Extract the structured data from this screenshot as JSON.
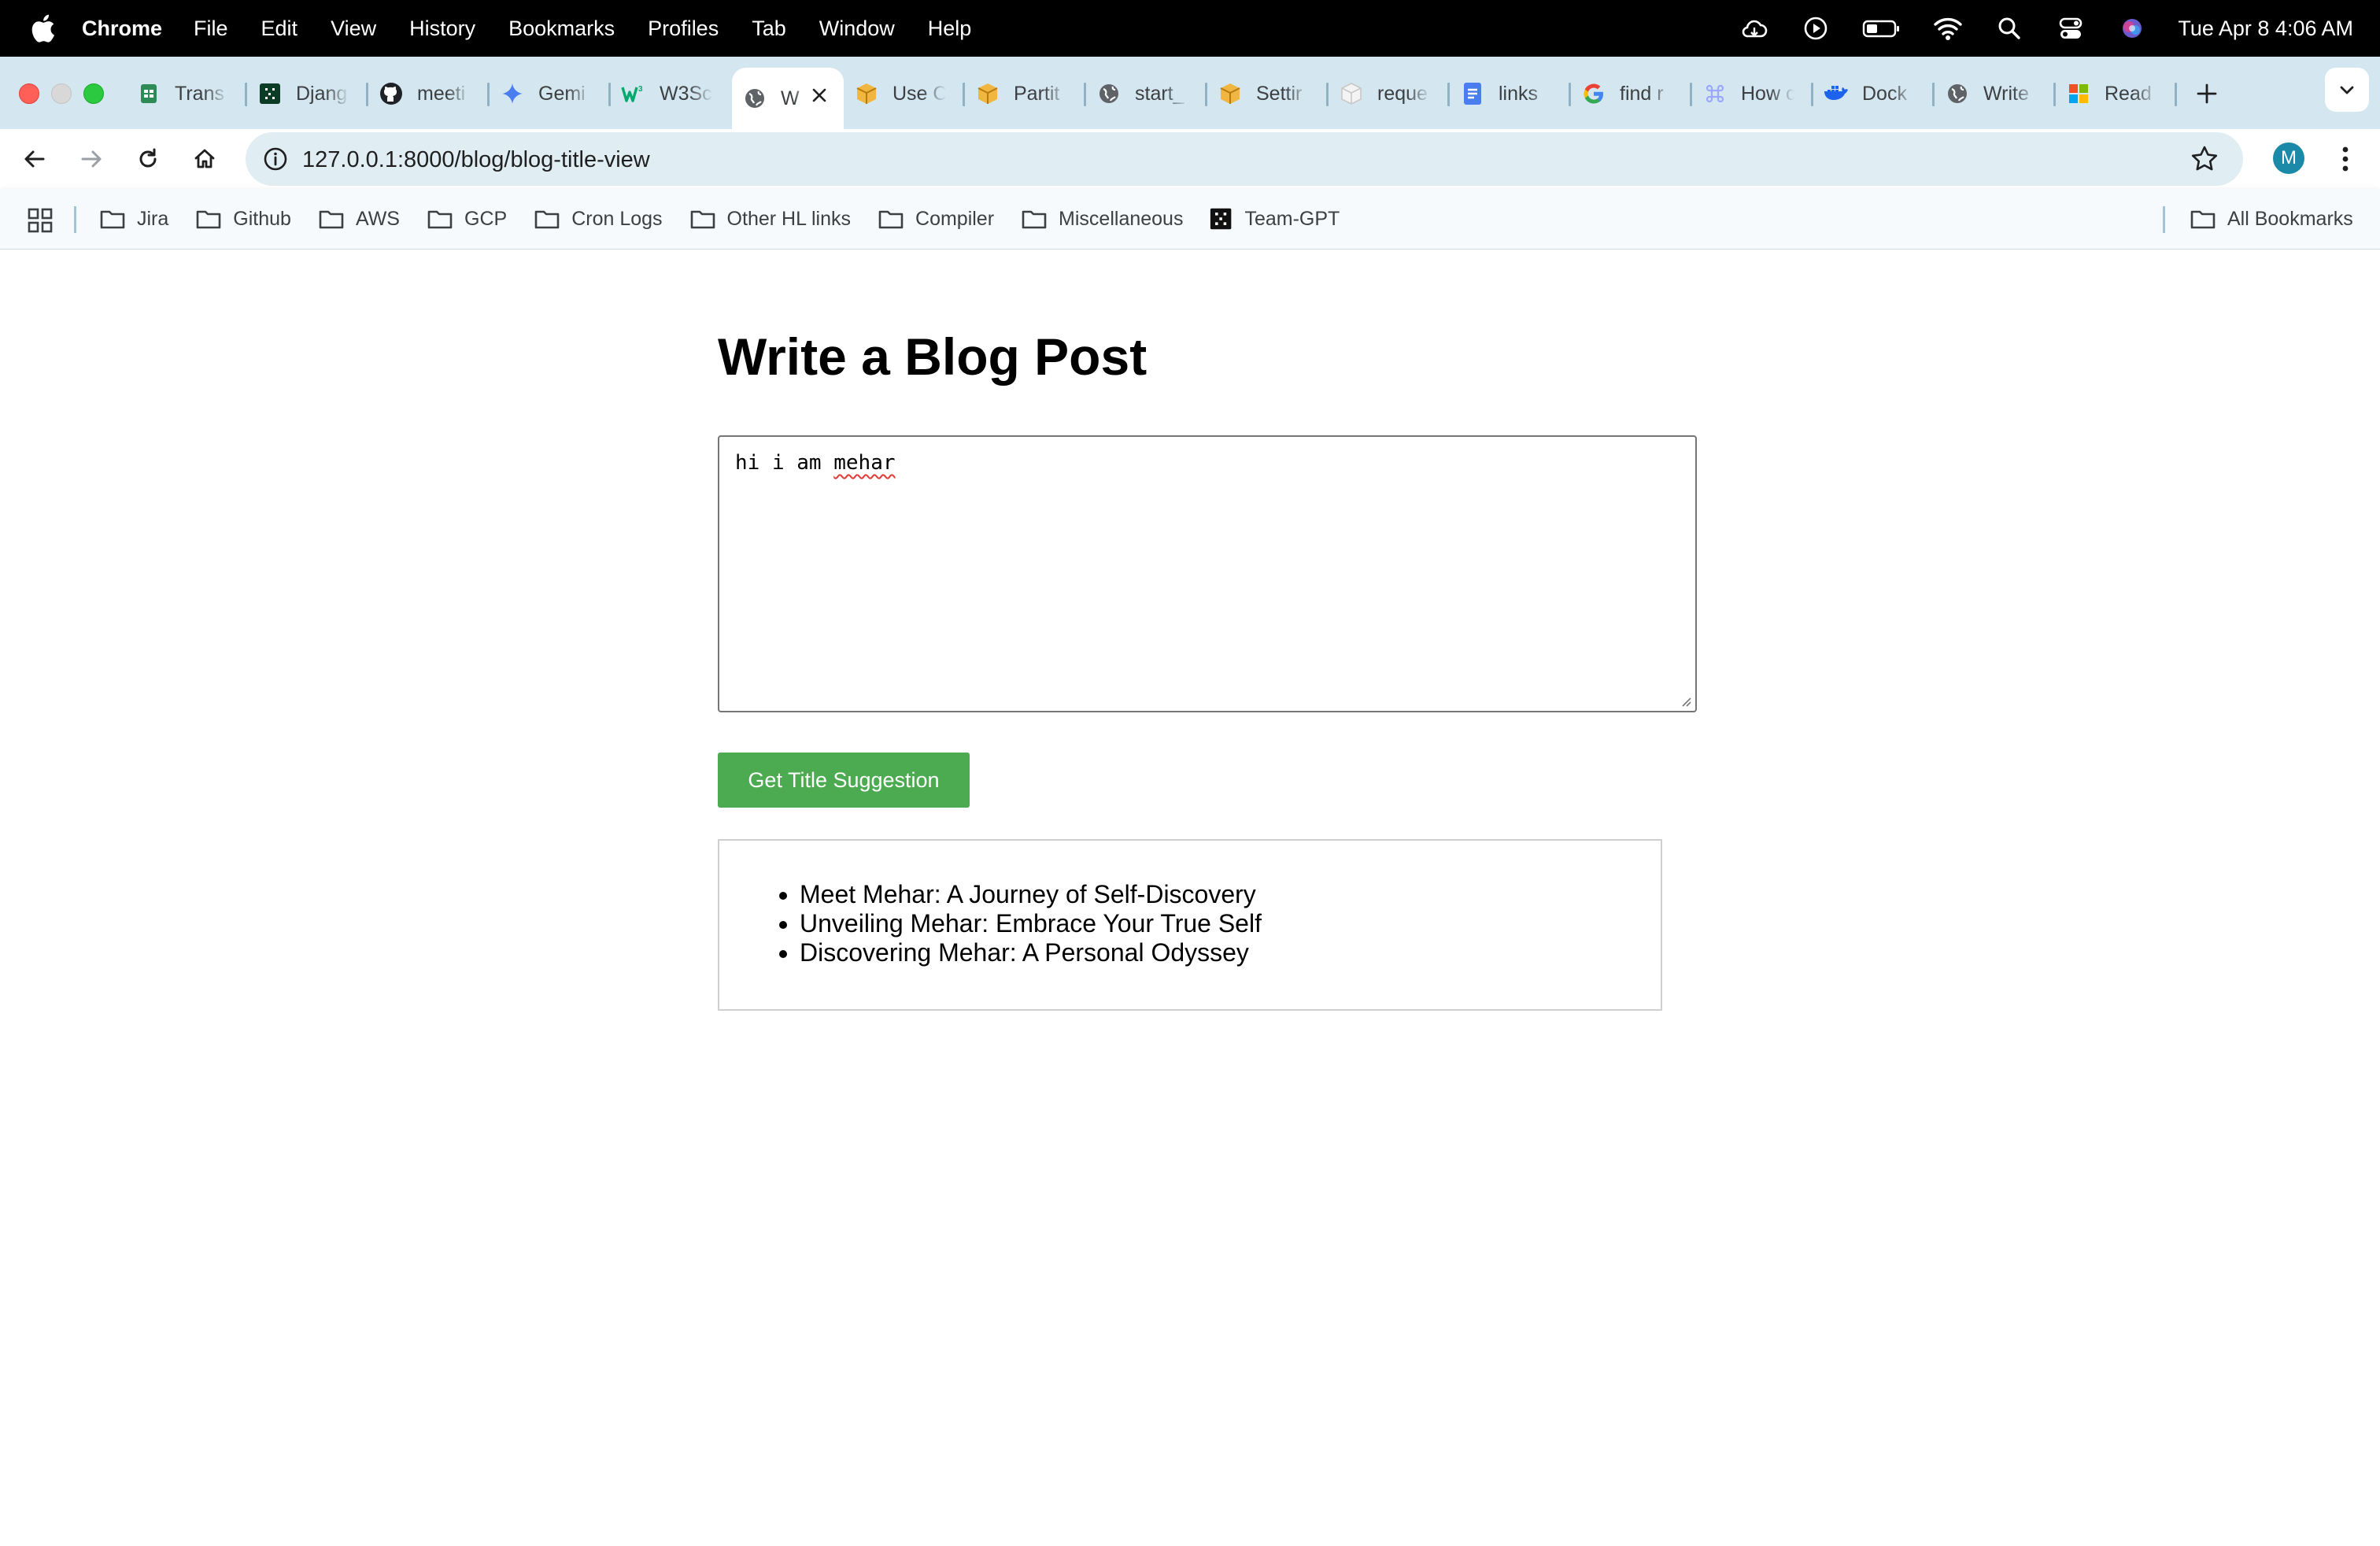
{
  "menubar": {
    "app_name": "Chrome",
    "items": [
      "File",
      "Edit",
      "View",
      "History",
      "Bookmarks",
      "Profiles",
      "Tab",
      "Window",
      "Help"
    ],
    "clock": "Tue Apr 8  4:06 AM",
    "status_icons": [
      "cloud-sync-icon",
      "play-icon",
      "battery-icon",
      "wifi-icon",
      "spotlight-search-icon",
      "control-center-icon",
      "siri-icon"
    ]
  },
  "tabs": [
    {
      "title": "Trans",
      "icon": "sheets-icon"
    },
    {
      "title": "Djang",
      "icon": "django-icon"
    },
    {
      "title": "meeti",
      "icon": "github-icon"
    },
    {
      "title": "Gemi",
      "icon": "gemini-icon"
    },
    {
      "title": "W3Sc",
      "icon": "w3schools-icon"
    },
    {
      "title": "W",
      "icon": "globe-icon",
      "active": true
    },
    {
      "title": "Use C",
      "icon": "box-icon"
    },
    {
      "title": "Partit",
      "icon": "box-icon"
    },
    {
      "title": "start_",
      "icon": "globe-icon"
    },
    {
      "title": "Settir",
      "icon": "box-icon"
    },
    {
      "title": "reque",
      "icon": "cube-icon"
    },
    {
      "title": "links",
      "icon": "docs-icon"
    },
    {
      "title": "find r",
      "icon": "google-icon"
    },
    {
      "title": "How c",
      "icon": "command-icon"
    },
    {
      "title": "Dock",
      "icon": "docker-icon"
    },
    {
      "title": "Write",
      "icon": "globe-icon"
    },
    {
      "title": "Read",
      "icon": "microsoft-icon"
    }
  ],
  "toolbar": {
    "url_host": "127.0.0.1",
    "url_rest": ":8000/blog/blog-title-view",
    "profile_initial": "M"
  },
  "bookmarks": {
    "items": [
      "Jira",
      "Github",
      "AWS",
      "GCP",
      "Cron Logs",
      "Other HL links",
      "Compiler",
      "Miscellaneous",
      "Team-GPT"
    ],
    "all_bookmarks": "All Bookmarks"
  },
  "page": {
    "title": "Write a Blog Post",
    "editor_text_before": "hi i am ",
    "editor_text_misspelled": "mehar",
    "button_label": "Get Title Suggestion",
    "suggestions": [
      "Meet Mehar: A Journey of Self-Discovery",
      "Unveiling Mehar: Embrace Your True Self",
      "Discovering Mehar: A Personal Odyssey"
    ]
  },
  "colors": {
    "tabstrip": "#d4e6ef",
    "omnibox": "#e0eef4",
    "button_green": "#4caa50",
    "profile_teal": "#1a8aa8"
  }
}
